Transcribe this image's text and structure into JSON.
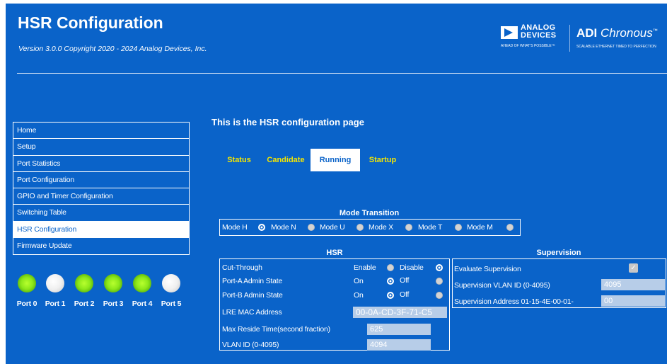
{
  "header": {
    "title": "HSR Configuration",
    "subtitle": "Version 3.0.0 Copyright 2020 - 2024 Analog Devices, Inc.",
    "logo": {
      "line1": "ANALOG",
      "line2": "DEVICES",
      "tagline": "AHEAD OF WHAT'S POSSIBLE™"
    },
    "product": {
      "name_bold": "ADI",
      "name_italic": "Chronous",
      "tm": "™",
      "tagline": "SCALABLE ETHERNET TIMED TO PERFECTION"
    }
  },
  "nav": {
    "items": [
      {
        "label": "Home"
      },
      {
        "label": "Setup"
      },
      {
        "label": "Port Statistics"
      },
      {
        "label": "Port Configuration"
      },
      {
        "label": "GPIO and Timer Configuration"
      },
      {
        "label": "Switching Table"
      },
      {
        "label": "HSR Configuration",
        "active": true
      },
      {
        "label": "Firmware Update"
      }
    ]
  },
  "ports": [
    {
      "label": "Port 0",
      "state": "on"
    },
    {
      "label": "Port 1",
      "state": "off"
    },
    {
      "label": "Port 2",
      "state": "on"
    },
    {
      "label": "Port 3",
      "state": "on"
    },
    {
      "label": "Port 4",
      "state": "on"
    },
    {
      "label": "Port 5",
      "state": "off"
    }
  ],
  "page": {
    "heading": "This is the HSR configuration page",
    "tabs": [
      {
        "label": "Status"
      },
      {
        "label": "Candidate"
      },
      {
        "label": "Running",
        "active": true
      },
      {
        "label": "Startup"
      }
    ]
  },
  "mode_transition": {
    "title": "Mode Transition",
    "options": [
      "Mode H",
      "Mode N",
      "Mode U",
      "Mode X",
      "Mode T",
      "Mode M"
    ],
    "selected_radio_after": "Mode H"
  },
  "hsr": {
    "title": "HSR",
    "cut_through": {
      "label": "Cut-Through",
      "enable": "Enable",
      "disable": "Disable",
      "selected": "Disable"
    },
    "port_a": {
      "label": "Port-A Admin State",
      "on": "On",
      "off": "Off",
      "selected": "Off"
    },
    "port_b": {
      "label": "Port-B Admin State",
      "on": "On",
      "off": "Off",
      "selected": "Off"
    },
    "lre_mac": {
      "label": "LRE MAC Address",
      "value": "00-0A-CD-3F-71-C5"
    },
    "max_reside": {
      "label": "Max Reside Time(second fraction)",
      "value": "625"
    },
    "vlan": {
      "label": "VLAN ID (0-4095)",
      "value": "4094"
    }
  },
  "supervision": {
    "title": "Supervision",
    "evaluate": {
      "label": "Evaluate Supervision",
      "checked": true,
      "check_glyph": "✓"
    },
    "vlan": {
      "label": "Supervision VLAN ID (0-4095)",
      "value": "4095"
    },
    "address": {
      "label": "Supervision Address 01-15-4E-00-01-",
      "value": "00"
    }
  },
  "colors": {
    "background": "#0a63c9",
    "tab_text": "#f5e600",
    "led_on": "#8de81a",
    "led_off": "#f0f0f0",
    "field_bg": "#b7cde8"
  }
}
